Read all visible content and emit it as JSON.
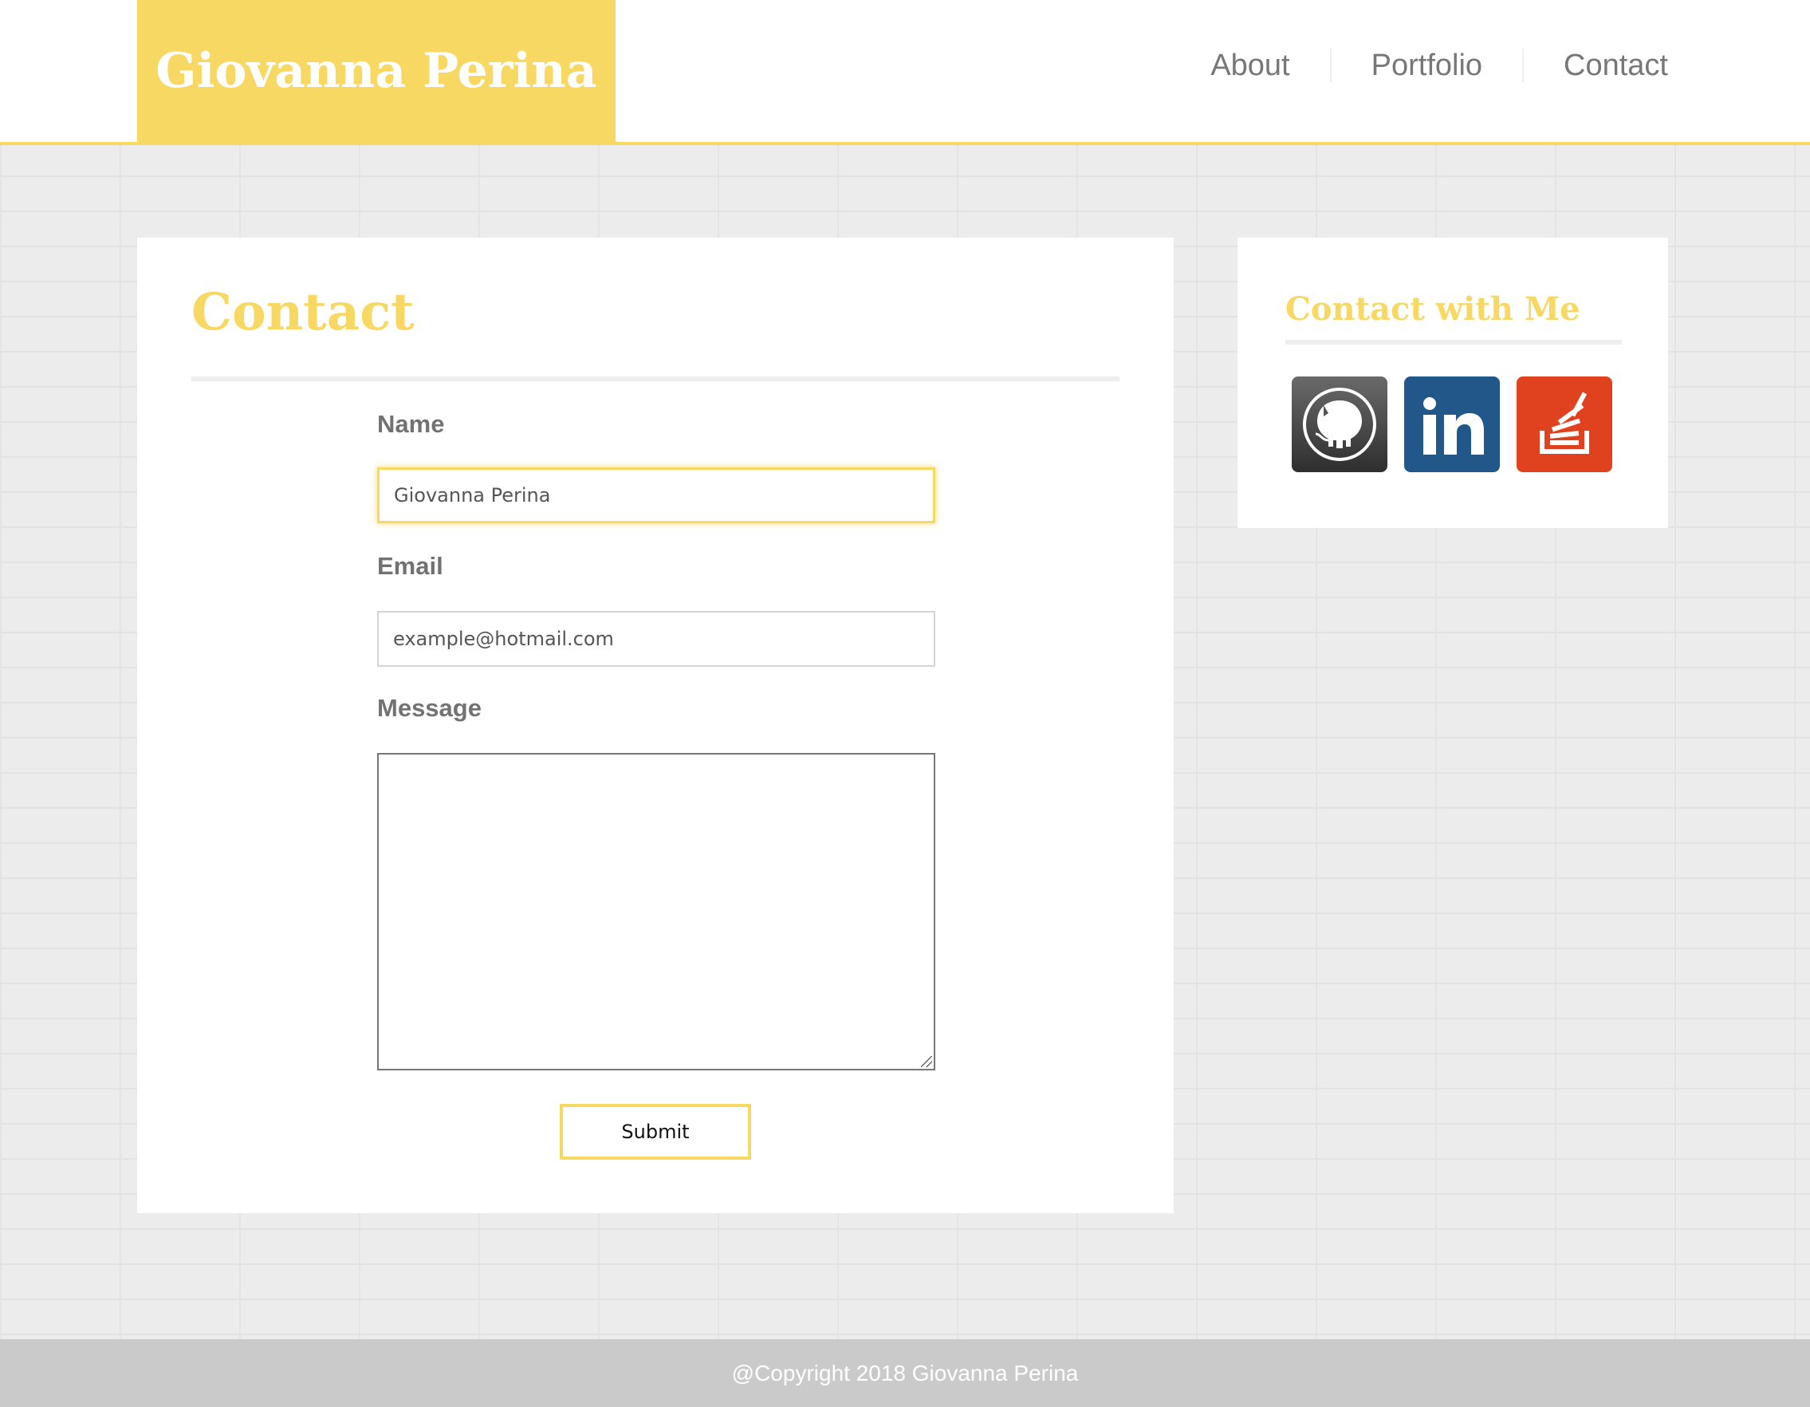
{
  "header": {
    "brand": "Giovanna Perina",
    "nav": [
      {
        "label": "About"
      },
      {
        "label": "Portfolio"
      },
      {
        "label": "Contact"
      }
    ]
  },
  "main": {
    "title": "Contact",
    "form": {
      "name_label": "Name",
      "name_value": "Giovanna Perina",
      "email_label": "Email",
      "email_placeholder": "example@hotmail.com",
      "message_label": "Message",
      "message_value": "",
      "submit_label": "Submit"
    }
  },
  "sidebar": {
    "title": "Contact with Me",
    "social": [
      {
        "name": "github-icon",
        "color": "#333333"
      },
      {
        "name": "linkedin-icon",
        "color": "#22578a"
      },
      {
        "name": "stackoverflow-icon",
        "color": "#e0411e"
      }
    ]
  },
  "footer": {
    "copyright": "@Copyright 2018 Giovanna Perina"
  },
  "colors": {
    "accent": "#f7d862",
    "text_gray": "#777777",
    "footer_bg": "#cacaca"
  }
}
